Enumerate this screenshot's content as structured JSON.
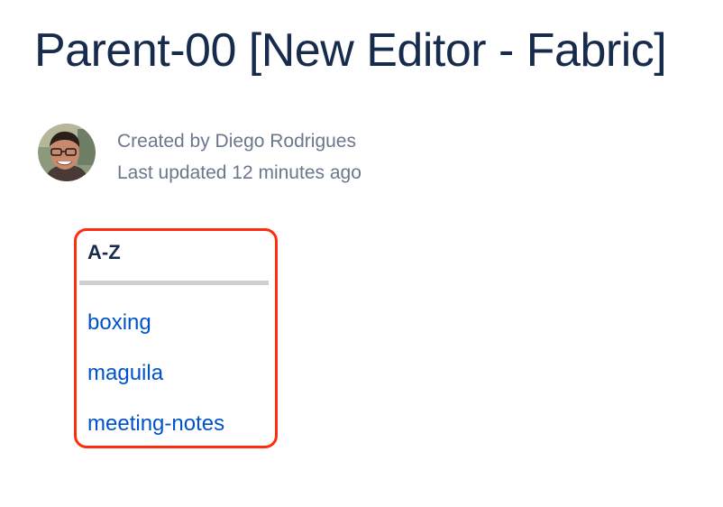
{
  "page": {
    "title": "Parent-00 [New Editor - Fabric]"
  },
  "byline": {
    "created": "Created by Diego Rodrigues",
    "updated": "Last updated 12 minutes ago",
    "avatar_icon": "user-avatar-photo"
  },
  "az_index": {
    "heading": "A-Z",
    "items": [
      {
        "label": "boxing"
      },
      {
        "label": "maguila"
      },
      {
        "label": "meeting-notes"
      }
    ]
  },
  "colors": {
    "title": "#172b4d",
    "meta_text": "#6b778c",
    "link": "#0052cc",
    "highlight_border": "#ff2d0e",
    "divider": "#cfcfcf"
  }
}
